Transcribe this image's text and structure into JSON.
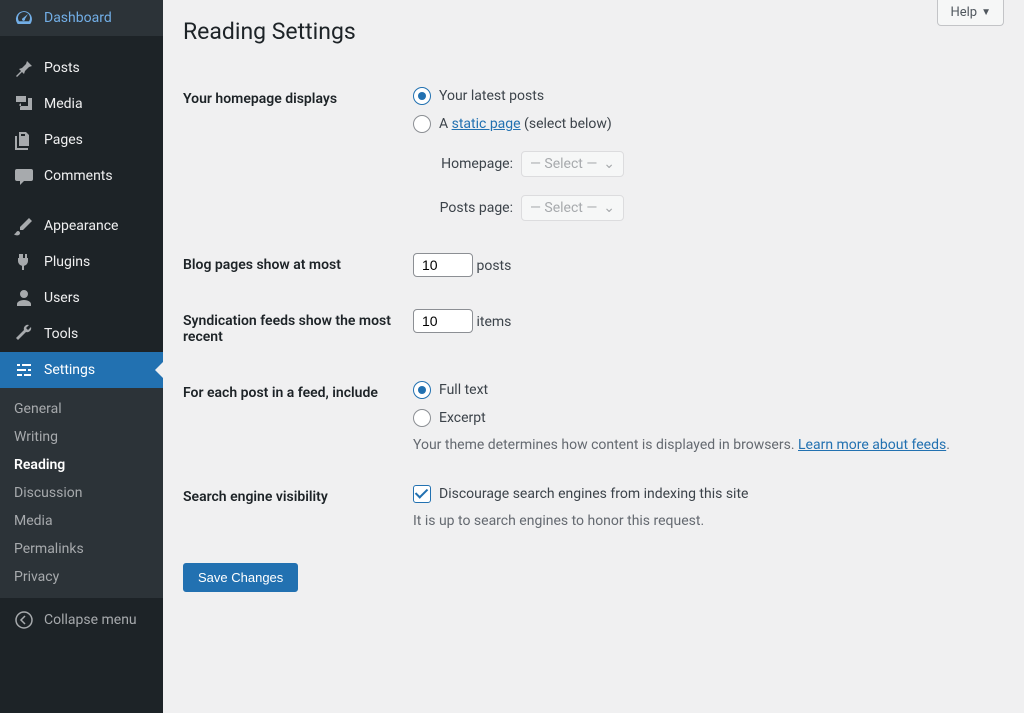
{
  "sidebar": {
    "items": [
      {
        "label": "Dashboard",
        "icon": "dashboard"
      },
      {
        "label": "Posts",
        "icon": "pin"
      },
      {
        "label": "Media",
        "icon": "media"
      },
      {
        "label": "Pages",
        "icon": "pages"
      },
      {
        "label": "Comments",
        "icon": "comment"
      },
      {
        "label": "Appearance",
        "icon": "brush"
      },
      {
        "label": "Plugins",
        "icon": "plug"
      },
      {
        "label": "Users",
        "icon": "user"
      },
      {
        "label": "Tools",
        "icon": "wrench"
      },
      {
        "label": "Settings",
        "icon": "sliders"
      }
    ],
    "submenu": [
      "General",
      "Writing",
      "Reading",
      "Discussion",
      "Media",
      "Permalinks",
      "Privacy"
    ],
    "collapse": "Collapse menu"
  },
  "help": "Help",
  "page_title": "Reading Settings",
  "homepage": {
    "heading": "Your homepage displays",
    "opt_latest": "Your latest posts",
    "opt_static_prefix": "A ",
    "opt_static_link": "static page",
    "opt_static_suffix": " (select below)",
    "homepage_label": "Homepage:",
    "posts_page_label": "Posts page:",
    "select_placeholder": "— Select —"
  },
  "blog_pages": {
    "heading": "Blog pages show at most",
    "value": "10",
    "suffix": "posts"
  },
  "syndication": {
    "heading": "Syndication feeds show the most recent",
    "value": "10",
    "suffix": "items"
  },
  "feed_content": {
    "heading": "For each post in a feed, include",
    "opt_full": "Full text",
    "opt_excerpt": "Excerpt",
    "desc_prefix": "Your theme determines how content is displayed in browsers. ",
    "desc_link": "Learn more about feeds",
    "desc_suffix": "."
  },
  "search": {
    "heading": "Search engine visibility",
    "checkbox_label": "Discourage search engines from indexing this site",
    "desc": "It is up to search engines to honor this request."
  },
  "submit": "Save Changes"
}
